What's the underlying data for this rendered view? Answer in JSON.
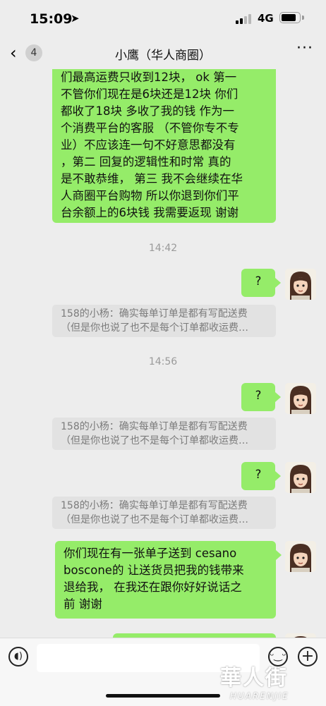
{
  "status_bar": {
    "time": "15:09",
    "network": "4G",
    "battery_level": 0.85
  },
  "nav": {
    "unread_count": "4",
    "title": "小鹰（华人商圈）"
  },
  "messages": {
    "m1_lines": [
      "们最高运费只收到12块， ok 第一",
      "不管你们现在是6块还是12块 你们",
      "都收了18块 多收了我的钱 作为一",
      "个消费平台的客服 （不管你专不专",
      "业）不应该连一句不好意思都没有",
      "，第二 回复的逻辑性和时常 真的",
      "是不敢恭维， 第三 我不会继续在华",
      "人商圈平台购物 所以你退到你们平",
      "台余额上的6块钱 我需要返现 谢谢"
    ],
    "stamp1": "14:42",
    "q_text": "?",
    "quote_line1": "158的小杨：确实每单订单是都有写配送费",
    "quote_line2": "（但是你也说了也不是每个订单都收运费…",
    "stamp2": "14:56",
    "m5_lines": [
      "你们现在有一张单子送到 cesano",
      "boscone的  让送货员把我的钱带来",
      "退给我，  在我还在跟你好好说话之",
      "前 谢谢"
    ]
  },
  "watermark": {
    "chinese": "華人街",
    "latin": "HUARENJIE"
  }
}
